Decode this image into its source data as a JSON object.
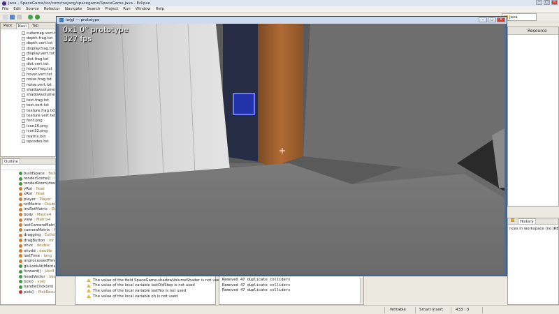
{
  "window": {
    "title": "Java - SpaceGame/src/com/mojang/spacegame/SpaceGame.java - Eclipse",
    "controls": [
      "–",
      "□",
      "×"
    ]
  },
  "menu": [
    "File",
    "Edit",
    "Source",
    "Refactor",
    "Navigate",
    "Search",
    "Project",
    "Run",
    "Window",
    "Help"
  ],
  "perspective": {
    "label": "Java",
    "icon": "java-perspective-icon"
  },
  "package_explorer": {
    "tabs": [
      "Pack",
      "Navi",
      "Typ"
    ],
    "files": [
      "cubemap.vert.txt",
      "depth.frag.txt",
      "depth.vert.txt",
      "display.frag.txt",
      "display.vert.txt",
      "dist.frag.txt",
      "dist.vert.txt",
      "hover.frag.txt",
      "hover.vert.txt",
      "noise.frag.txt",
      "noise.vert.txt",
      "shadowvolume",
      "shadowvolume",
      "test.frag.txt",
      "test.vert.txt",
      "texture.frag.txt",
      "texture.vert.txt",
      "font.png",
      "icon16.png",
      "icon32.png",
      "matrix.bin",
      "opcodes.txt"
    ]
  },
  "outline": {
    "tab": "Outline",
    "items": [
      {
        "name": "buildSpace",
        "type": ": BuildS",
        "color": "#3c9a3c"
      },
      {
        "name": "renderScene()",
        "type": ": void",
        "color": "#3c9a3c"
      },
      {
        "name": "renderRoom(double",
        "type": "",
        "color": "#3c9a3c"
      },
      {
        "name": "yRot",
        "type": ": float",
        "color": "#d07a2a"
      },
      {
        "name": "xRot",
        "type": ": float",
        "color": "#d07a2a"
      },
      {
        "name": "player",
        "type": ": Player",
        "color": "#d07a2a"
      },
      {
        "name": "rotMatrix",
        "type": ": Double",
        "color": "#d07a2a"
      },
      {
        "name": "invRotMatrix",
        "type": ": Dou",
        "color": "#d07a2a"
      },
      {
        "name": "body",
        "type": ": Matrix4",
        "color": "#d07a2a"
      },
      {
        "name": "view",
        "type": ": Matrix4",
        "color": "#d07a2a"
      },
      {
        "name": "lastCameraMatrix",
        "type": ": M",
        "color": "#d07a2a"
      },
      {
        "name": "cameraMatrix",
        "type": ": Matr",
        "color": "#d07a2a"
      },
      {
        "name": "dragging",
        "type": ": Collidab",
        "color": "#d07a2a"
      },
      {
        "name": "dragButton",
        "type": ": int",
        "color": "#d07a2a"
      },
      {
        "name": "ohvx",
        "type": ": double",
        "color": "#d07a2a"
      },
      {
        "name": "ohvdd",
        "type": ": double",
        "color": "#d07a2a"
      },
      {
        "name": "lastTime",
        "type": ": long",
        "color": "#d07a2a"
      },
      {
        "name": "unprocessedTime",
        "type": ": ",
        "color": "#d07a2a"
      },
      {
        "name": "gluLookAt(Matrix4,",
        "type": "",
        "color": "#3c9a3c"
      },
      {
        "name": "forward()",
        "type": ": Vec3",
        "color": "#3c9a3c"
      },
      {
        "name": "headVector",
        "type": ": Vec3",
        "color": "#3c9a3c"
      },
      {
        "name": "tick()",
        "type": ": void",
        "color": "#3c9a3c"
      },
      {
        "name": "handleClick(int)",
        "type": ": void",
        "color": "#3c9a3c"
      },
      {
        "name": "pick()",
        "type": ": PickResult",
        "color": "#c83232"
      }
    ]
  },
  "game_window": {
    "title": "lwjgl — prototype",
    "hud_line1": "0x1 0° prototype",
    "hud_line2": "327 fps"
  },
  "right_top": {
    "header": "Resource"
  },
  "right_bottom": {
    "tabs": [
      "",
      "History"
    ],
    "text": "nces in workspace (no JRE) (0"
  },
  "problems": [
    "The value of the field SpaceGame.shadowVolumeShader is not used",
    "The value of the local variable lastOldStep is not used",
    "The value of the local variable lastTex is not used",
    "The value of the local variable oh is not used"
  ],
  "console": [
    "Removed 47 duplicate colliders",
    "Removed 47 duplicate colliders",
    "Removed 47 duplicate colliders"
  ],
  "status": {
    "writable": "Writable",
    "insert": "Smart Insert",
    "position": "433 : 3"
  }
}
